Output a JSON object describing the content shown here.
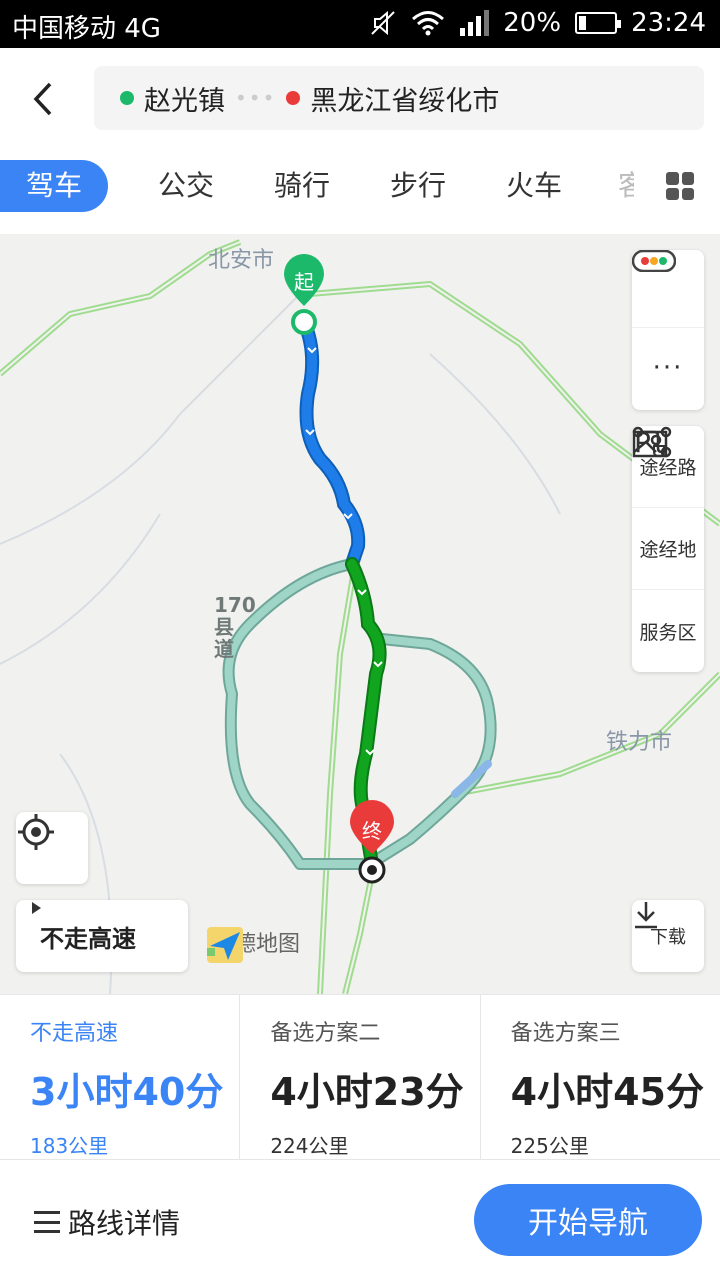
{
  "status_bar": {
    "carrier": "中国移动 4G",
    "battery": "20%",
    "battery_level": 0.2,
    "time": "23:24"
  },
  "header": {
    "origin": "赵光镇",
    "destination": "黑龙江省绥化市",
    "tabs": [
      "驾车",
      "公交",
      "骑行",
      "步行",
      "火车",
      "客"
    ]
  },
  "map": {
    "labels": {
      "city_north": "北安市",
      "city_east": "铁力市",
      "road": "170县道"
    },
    "start_marker": "起",
    "end_marker": "终",
    "panel": {
      "waypoint_route": "途经路",
      "waypoint_place": "途经地",
      "service_area": "服务区"
    },
    "avoid_highway": "不走高速",
    "brand": "高德地图",
    "download": "下载"
  },
  "plans": [
    {
      "name": "不走高速",
      "time": "3小时40分",
      "distance": "183公里"
    },
    {
      "name": "备选方案二",
      "time": "4小时23分",
      "distance": "224公里"
    },
    {
      "name": "备选方案三",
      "time": "4小时45分",
      "distance": "225公里"
    }
  ],
  "footer": {
    "details": "路线详情",
    "start": "开始导航"
  },
  "colors": {
    "accent": "#3b84f5",
    "route_blue": "#1e7de8",
    "route_green": "#11a41e",
    "alt_route": "#8fcfc0"
  }
}
